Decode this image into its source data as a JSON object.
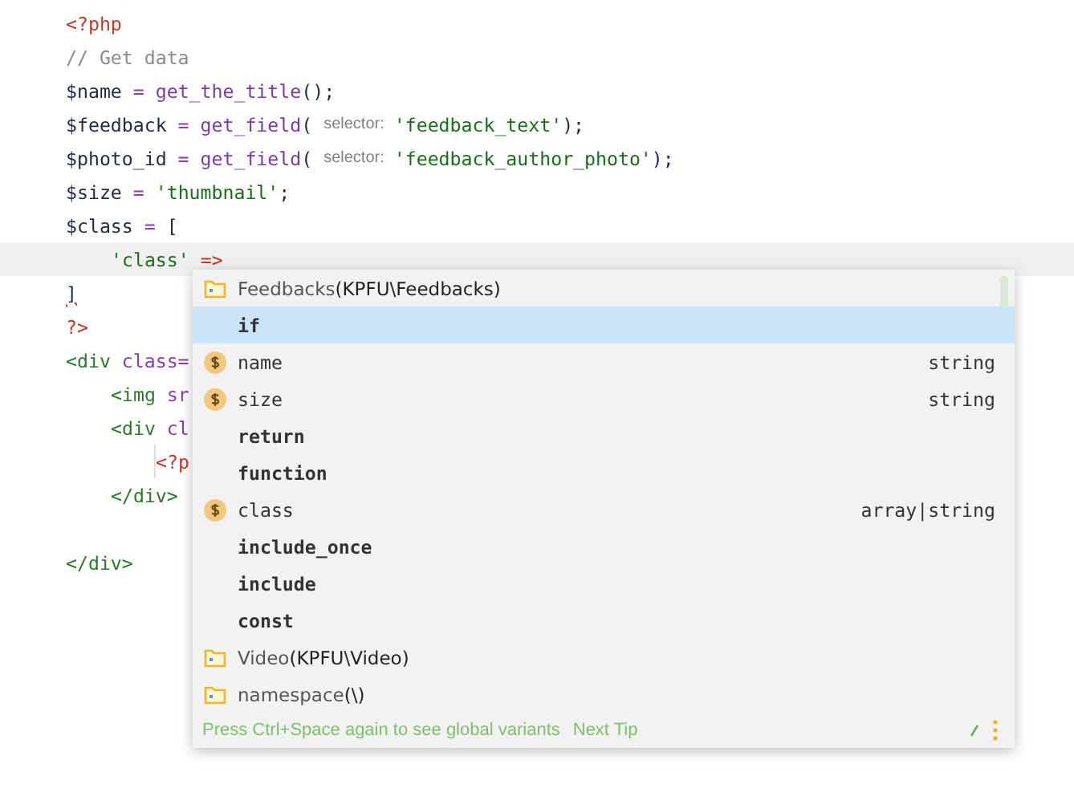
{
  "code_lines": [
    {
      "segments": [
        {
          "text": "<?php",
          "kind": "tag"
        }
      ]
    },
    {
      "segments": [
        {
          "text": "// Get data",
          "kind": "comment"
        }
      ]
    },
    {
      "segments": [
        {
          "text": "$name",
          "kind": "var"
        },
        {
          "text": " = ",
          "kind": "op"
        },
        {
          "text": "get_the_title",
          "kind": "func"
        },
        {
          "text": "();",
          "kind": "plain"
        }
      ]
    },
    {
      "segments": [
        {
          "text": "$feedback",
          "kind": "var"
        },
        {
          "text": " = ",
          "kind": "op"
        },
        {
          "text": "get_field",
          "kind": "func"
        },
        {
          "text": "( ",
          "kind": "plain"
        },
        {
          "text": "selector:",
          "kind": "hint"
        },
        {
          "text": "'feedback_text'",
          "kind": "string"
        },
        {
          "text": ");",
          "kind": "plain"
        }
      ]
    },
    {
      "segments": [
        {
          "text": "$photo_id",
          "kind": "var"
        },
        {
          "text": " = ",
          "kind": "op"
        },
        {
          "text": "get_field",
          "kind": "func"
        },
        {
          "text": "( ",
          "kind": "plain"
        },
        {
          "text": "selector:",
          "kind": "hint"
        },
        {
          "text": "'feedback_author_photo'",
          "kind": "string"
        },
        {
          "text": ");",
          "kind": "plain"
        }
      ]
    },
    {
      "segments": [
        {
          "text": "$size",
          "kind": "var"
        },
        {
          "text": " = ",
          "kind": "op"
        },
        {
          "text": "'thumbnail'",
          "kind": "string"
        },
        {
          "text": ";",
          "kind": "plain"
        }
      ]
    },
    {
      "segments": [
        {
          "text": "$class",
          "kind": "var"
        },
        {
          "text": " = ",
          "kind": "op"
        },
        {
          "text": "[",
          "kind": "plain"
        }
      ],
      "children": [
        {
          "current": true,
          "segments": [
            {
              "text": "'class'",
              "kind": "string"
            },
            {
              "text": " =>",
              "kind": "tag"
            }
          ]
        }
      ]
    },
    {
      "segments": [
        {
          "text": "]",
          "kind": "error"
        }
      ]
    },
    {
      "segments": [
        {
          "text": "?>",
          "kind": "tag"
        }
      ]
    },
    {
      "segments": [
        {
          "text": "<div",
          "kind": "html"
        },
        {
          "text": " class=",
          "kind": "attr"
        }
      ],
      "children": [
        {
          "segments": [
            {
              "text": "<img",
              "kind": "html"
            },
            {
              "text": " sr",
              "kind": "attr"
            }
          ]
        },
        {
          "segments": [
            {
              "text": "<div",
              "kind": "html"
            },
            {
              "text": " cl",
              "kind": "attr"
            }
          ],
          "children": [
            {
              "guide": true,
              "segments": [
                {
                  "text": "<?p",
                  "kind": "tag"
                }
              ]
            }
          ]
        },
        {
          "segments": [
            {
              "text": "</div>",
              "kind": "html"
            }
          ]
        }
      ]
    },
    {
      "blank_before": true,
      "segments": [
        {
          "text": "</div>",
          "kind": "html"
        }
      ]
    }
  ],
  "completion": {
    "items": [
      {
        "kind": "namespace",
        "label": "Feedbacks",
        "detail": "(KPFU\\Feedbacks)",
        "selected": false
      },
      {
        "kind": "keyword",
        "label": "if",
        "selected": true
      },
      {
        "kind": "variable",
        "label": "name",
        "type": "string",
        "selected": false
      },
      {
        "kind": "variable",
        "label": "size",
        "type": "string",
        "selected": false
      },
      {
        "kind": "keyword",
        "label": "return",
        "selected": false
      },
      {
        "kind": "keyword",
        "label": "function",
        "selected": false
      },
      {
        "kind": "variable",
        "label": "class",
        "type": "array|string",
        "selected": false
      },
      {
        "kind": "keyword",
        "label": "include_once",
        "selected": false
      },
      {
        "kind": "keyword",
        "label": "include",
        "selected": false
      },
      {
        "kind": "keyword",
        "label": "const",
        "selected": false
      },
      {
        "kind": "namespace",
        "label": "Video",
        "detail": "(KPFU\\Video)",
        "selected": false
      },
      {
        "kind": "namespace",
        "label": "namespace",
        "detail": "(\\)",
        "selected": false
      }
    ],
    "footer": {
      "hint": "Press Ctrl+Space again to see global variants",
      "link": "Next Tip"
    }
  }
}
